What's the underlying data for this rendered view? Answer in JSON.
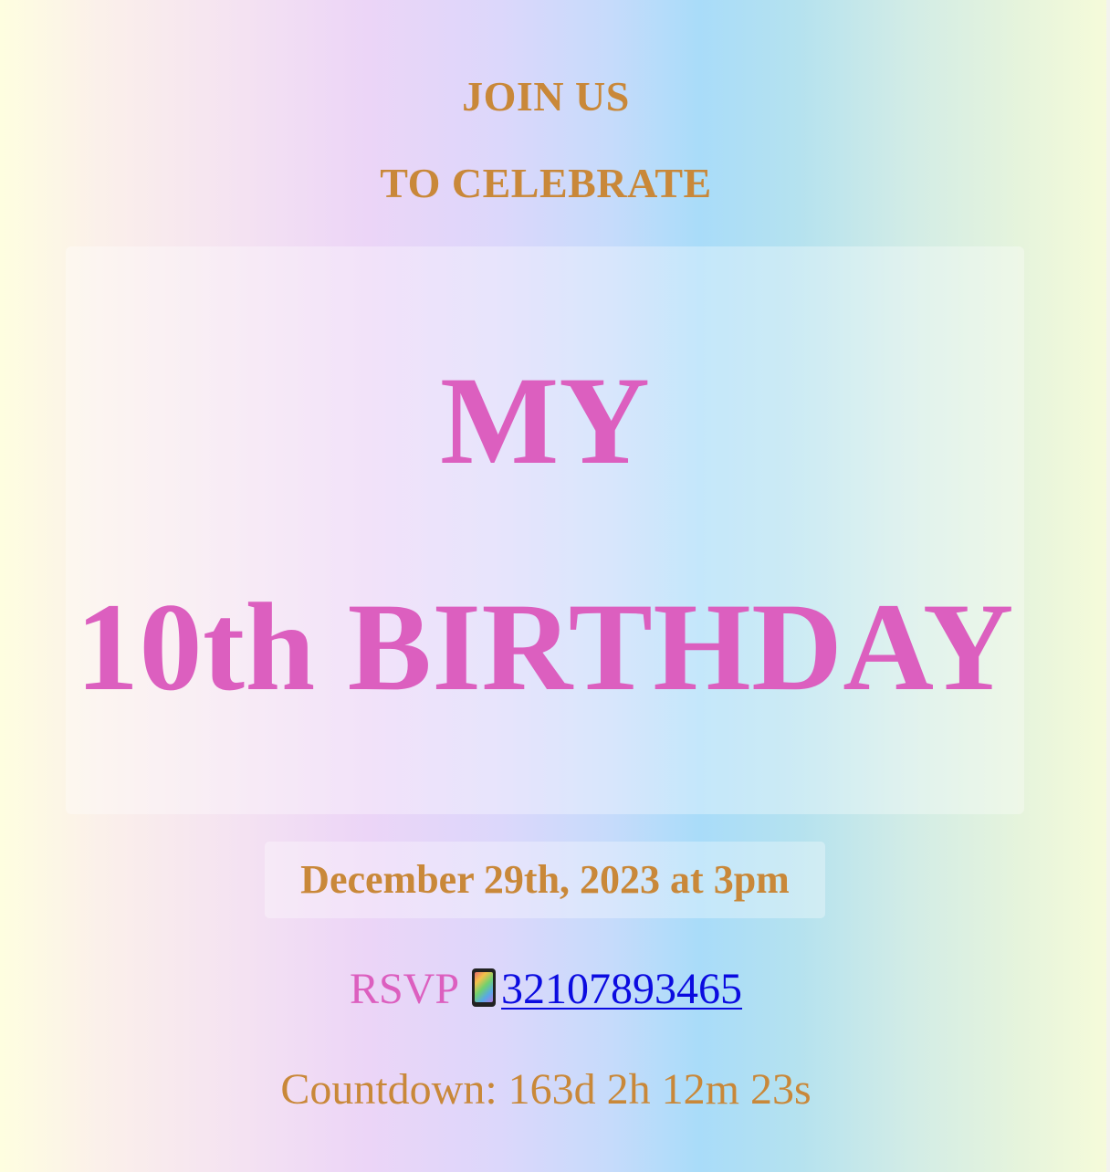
{
  "header": {
    "line1": "JOIN US",
    "line2": "TO CELEBRATE"
  },
  "hero": {
    "line1": "MY",
    "line2": "10th BIRTHDAY"
  },
  "event": {
    "date_text": "December 29th, 2023 at 3pm"
  },
  "rsvp": {
    "label": "RSVP",
    "icon": "mobile-phone-icon",
    "phone": "32107893465"
  },
  "countdown": {
    "text": "Countdown: 163d 2h 12m 23s"
  },
  "colors": {
    "accent_gold": "#c98839",
    "accent_pink": "#dc5fbf",
    "link_blue": "#0b0be0"
  }
}
